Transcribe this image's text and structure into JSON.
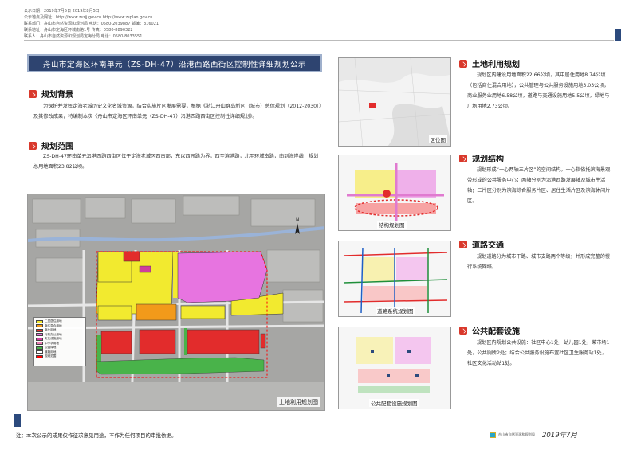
{
  "info": {
    "lines": [
      "公示日期：2019年7月5日    2019年8月5日",
      "公示地点及网址：http://www.zszjj.gov.cn    http://www.zsplan.gov.cn",
      "联系部门：舟山市自然资源和规划局  电话：0580-2039887  邮编：316021",
      "联系地址：舟山市定海区环城南路1号  传真：0580-8890322",
      "联系人：舟山市自然资源和规划局定海分局  电话：0580-8033551"
    ]
  },
  "title": "舟山市定海区环南单元（ZS-DH-47）沿港西路西街区控制性详细规划公示",
  "sections": {
    "background": {
      "heading": "规划背景",
      "text": "为保护并发挥定海老城历史文化名城资源，结合实施片区发展需要，根据《浙江舟山群岛新区（城市）总体规划（2012-2030）》及其修改成果，特编制本次《舟山市定海区环南单元（ZS-DH-47）沿港西路西街区控制性详细规划》。"
    },
    "scope": {
      "heading": "规划范围",
      "text": "ZS-DH-47环南单元沿港西路西街区位于定海老城区西南部，东以西园路为界，西至滨港路，北至环城南路，南到海岸线，规划总用地面积23.82公顷。"
    },
    "landuse": {
      "heading": "土地利用规划",
      "text": "规划区内建设用地面积22.66公顷，其中居住用地8.74公顷（包括商住混合用地），公共管理与公共服务设施用地3.03公顷，商业服务业用地6.58公顷，道路与交通设施用地5.5公顷，绿地与广场用地2.73公顷。"
    },
    "structure": {
      "heading": "规划结构",
      "text": "规划形成“一心两轴三片区”的空间结构。一心指依托滨海景观带形成的公共服务中心；两轴分别为沿港西路发展轴及城市生活轴；三片区分别为滨海综合服务片区、居住生活片区及滨海休闲片区。"
    },
    "traffic": {
      "heading": "道路交通",
      "text": "规划道路分为城市干路、城市支路两个等级；并形成完整的慢行系统网络。"
    },
    "facilities": {
      "heading": "公共配套设施",
      "text": "规划区内规划公共设施：社区中心1处，幼儿园1处，菜市场1处，公共厕所2处；结合公共服务设施布置社区卫生服务站1处，社区文化活动站1处。"
    }
  },
  "maps": {
    "big": "土地利用规划图",
    "location": "区位图",
    "structure": "结构规划图",
    "traffic": "道路系统规划图",
    "facilities": "公共配套设施规划图"
  },
  "legend": [
    {
      "label": "二类居住用地",
      "color": "#f2ea2f"
    },
    {
      "label": "商住混合用地",
      "color": "#f29a1a"
    },
    {
      "label": "商业用地",
      "color": "#e22c2c"
    },
    {
      "label": "行政办公用地",
      "color": "#e774e0"
    },
    {
      "label": "文化设施用地",
      "color": "#cf3f9d"
    },
    {
      "label": "中小学用地",
      "color": "#ee7eb5"
    },
    {
      "label": "公园绿地",
      "color": "#49b34a"
    },
    {
      "label": "道路用地",
      "color": "#ffffff"
    },
    {
      "label": "规划范围",
      "color": "#ff0000"
    }
  ],
  "footer": {
    "note": "注：本次公示的成果仅作征求意见用途，不作为任何项目的审批依据。",
    "brand": "舟山市自然资源和规划局",
    "date": "2019年7月"
  }
}
